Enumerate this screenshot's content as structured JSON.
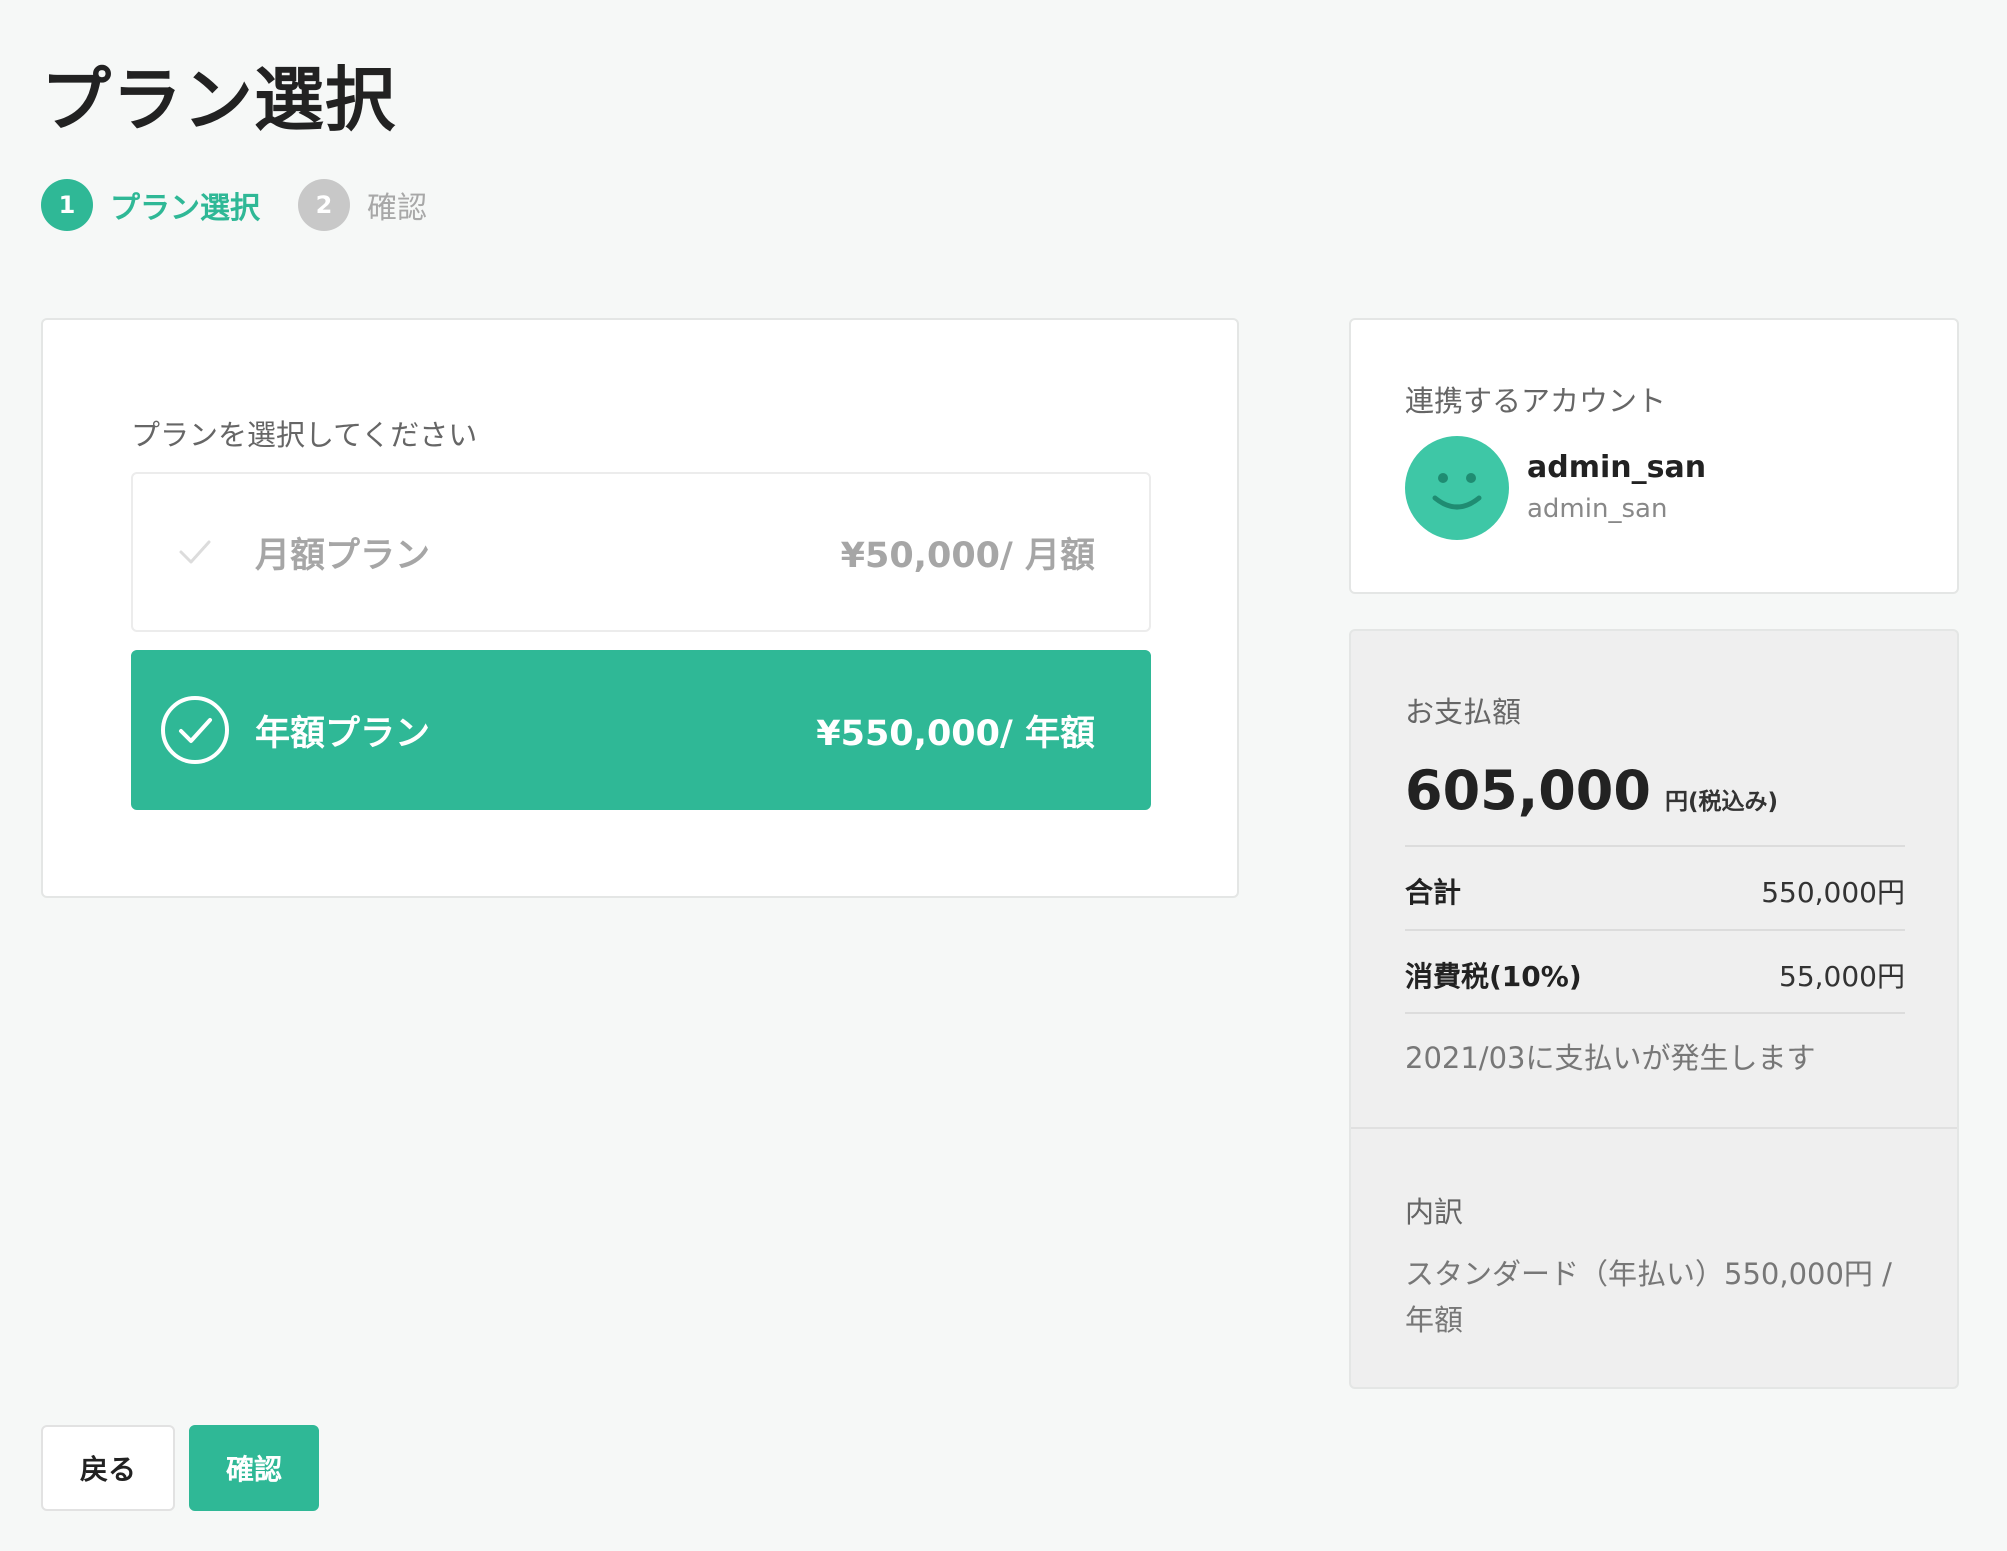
{
  "page": {
    "title": "プラン選択"
  },
  "steps": [
    {
      "number": "1",
      "label": "プラン選択",
      "state": "active"
    },
    {
      "number": "2",
      "label": "確認",
      "state": "inactive"
    }
  ],
  "plan_select": {
    "prompt": "プランを選択してください",
    "options": [
      {
        "name": "月額プラン",
        "price": "¥50,000/ 月額",
        "selected": false
      },
      {
        "name": "年額プラン",
        "price": "¥550,000/ 年額",
        "selected": true
      }
    ]
  },
  "account": {
    "title": "連携するアカウント",
    "display_name": "admin_san",
    "username": "admin_san",
    "avatar_icon": "smiley-face-icon",
    "avatar_color": "#3ec7a6"
  },
  "payment": {
    "title": "お支払額",
    "amount": "605,000",
    "unit": "円(税込み)",
    "rows": [
      {
        "label": "合計",
        "value": "550,000円"
      },
      {
        "label": "消費税(10%)",
        "value": "55,000円"
      }
    ],
    "note": "2021/03に支払いが発生します",
    "breakdown_title": "内訳",
    "breakdown_text": "スタンダード（年払い）550,000円 / 年額"
  },
  "actions": {
    "back_label": "戻る",
    "confirm_label": "確認"
  },
  "colors": {
    "accent": "#2fb896",
    "inactive": "#c8c8c8"
  }
}
